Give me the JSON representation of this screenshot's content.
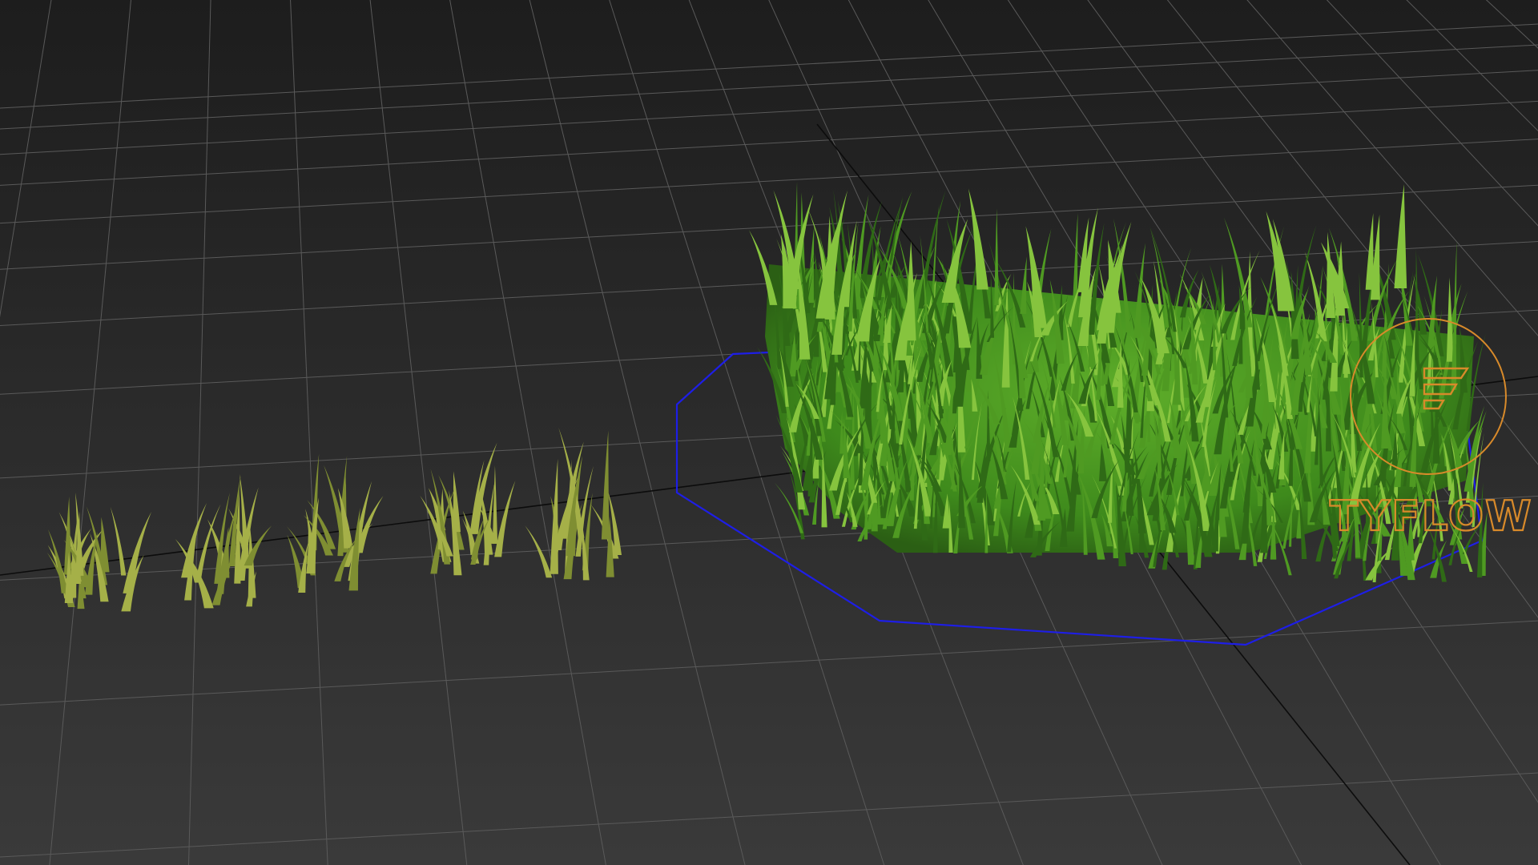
{
  "viewport": {
    "background_top": "#1d1d1d",
    "background_bottom": "#3a3a3a",
    "grid_color": "#5a5a5a",
    "axis_color": "#0c0c0c",
    "selection_outline_color": "#1e1ee6",
    "gizmo_color": "#d88a2a",
    "grass_colors": {
      "dark": "#2f6a16",
      "mid": "#4f9a22",
      "light": "#86c43e",
      "yellow": "#a5b048"
    }
  },
  "tyflow_gizmo": {
    "icon": "tyflow-gizmo-icon",
    "label": "TYFLOW"
  },
  "scene": {
    "objects": [
      {
        "name": "grass-patch",
        "kind": "scattered grass"
      },
      {
        "name": "young-plant-sprouts",
        "kind": "growth stages",
        "count": 5
      }
    ]
  }
}
